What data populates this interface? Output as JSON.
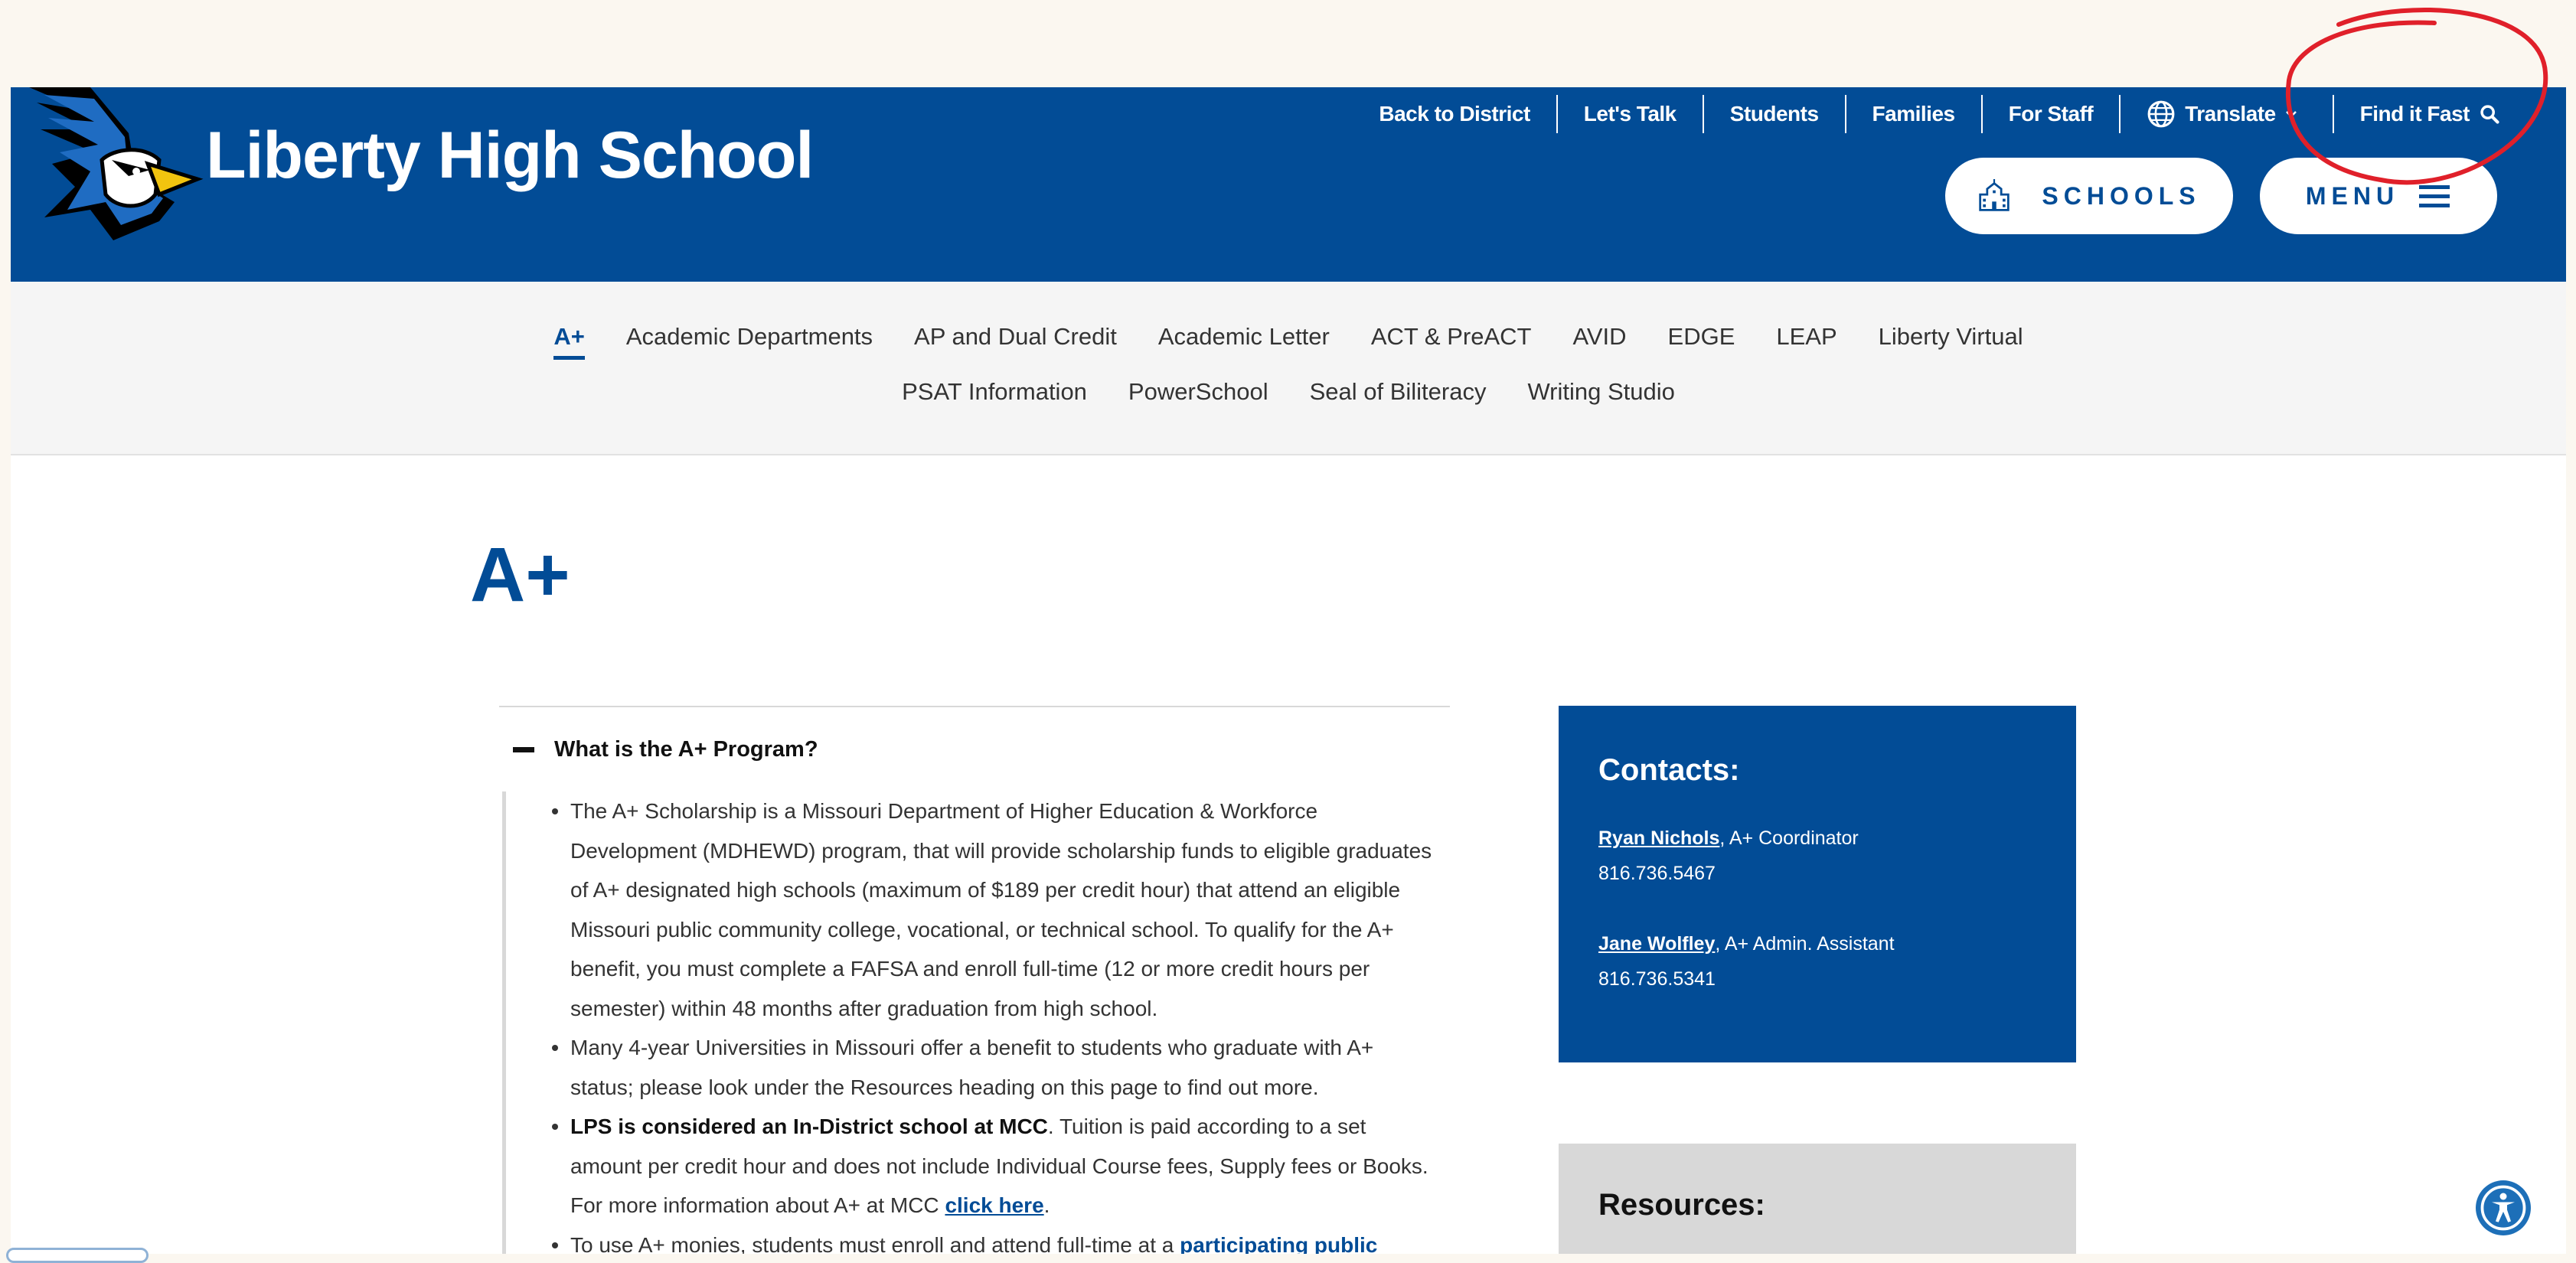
{
  "site": {
    "title": "Liberty High School",
    "brand_color": "#024c96"
  },
  "utility_nav": {
    "items": [
      "Back to District",
      "Let's Talk",
      "Students",
      "Families",
      "For Staff"
    ],
    "translate": "Translate",
    "find_it_fast": "Find it Fast"
  },
  "buttons": {
    "schools": "SCHOOLS",
    "menu": "MENU"
  },
  "subnav": {
    "row1": [
      "A+",
      "Academic Departments",
      "AP and Dual Credit",
      "Academic Letter",
      "ACT & PreACT",
      "AVID",
      "EDGE",
      "LEAP",
      "Liberty Virtual"
    ],
    "row2": [
      "PSAT Information",
      "PowerSchool",
      "Seal of Biliteracy",
      "Writing Studio"
    ],
    "active": "A+"
  },
  "page": {
    "title": "A+"
  },
  "accordion": {
    "heading": "What is the A+ Program?",
    "bullet1": "The A+ Scholarship is a Missouri Department of Higher Education & Workforce Development (MDHEWD) program, that will provide scholarship funds to eligible graduates of A+ designated high schools (maximum of $189 per credit hour) that attend an eligible Missouri public community college, vocational, or technical school. To qualify for the A+ benefit, you must complete a FAFSA and enroll full-time (12 or more credit hours per semester) within 48 months after graduation from high school.",
    "bullet2": "Many 4-year Universities in Missouri offer a benefit to students who graduate with A+ status; please look under the Resources heading on this page to find out more.",
    "bullet3_bold": "LPS is considered an In-District school at MCC",
    "bullet3_text": ". Tuition is paid according to a set amount per credit hour and does not include Individual Course fees, Supply fees or Books. For more information about A+ at MCC ",
    "bullet3_link": "click here",
    "bullet3_end": ".",
    "bullet4_text": "To use A+ monies, students must enroll and attend full-time at a ",
    "bullet4_link": "participating public"
  },
  "contacts": {
    "heading": "Contacts:",
    "people": [
      {
        "name": "Ryan Nichols",
        "role": ", A+ Coordinator",
        "phone": "816.736.5467"
      },
      {
        "name": "Jane Wolfley",
        "role": ", A+ Admin. Assistant",
        "phone": "816.736.5341"
      }
    ]
  },
  "resources": {
    "heading": "Resources:"
  },
  "icons": [
    "bluejay-logo",
    "globe-icon",
    "chevron-down-icon",
    "search-icon",
    "school-building-icon",
    "hamburger-icon",
    "accessibility-icon",
    "minus-icon"
  ]
}
